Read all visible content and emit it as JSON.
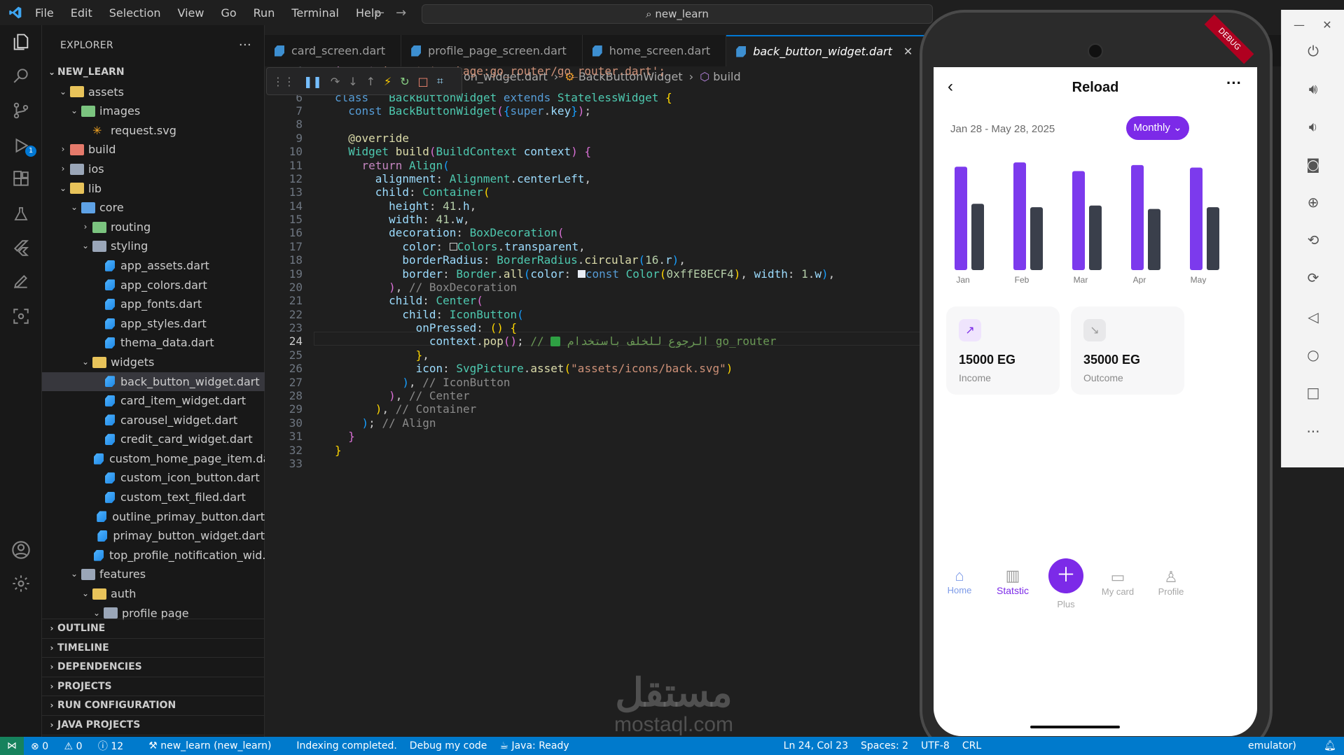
{
  "menu": [
    "File",
    "Edit",
    "Selection",
    "View",
    "Go",
    "Run",
    "Terminal",
    "Help"
  ],
  "search": {
    "text": "new_learn"
  },
  "explorer": {
    "title": "EXPLORER",
    "root": "NEW_LEARN",
    "tree": [
      {
        "label": "assets",
        "depth": 1,
        "kind": "folder-open",
        "color": "yel"
      },
      {
        "label": "images",
        "depth": 2,
        "kind": "folder-open",
        "color": "green"
      },
      {
        "label": "request.svg",
        "depth": 3,
        "kind": "svg"
      },
      {
        "label": "build",
        "depth": 1,
        "kind": "folder",
        "color": "red"
      },
      {
        "label": "ios",
        "depth": 1,
        "kind": "folder",
        "color": "grey"
      },
      {
        "label": "lib",
        "depth": 1,
        "kind": "folder-open",
        "color": "yel"
      },
      {
        "label": "core",
        "depth": 2,
        "kind": "folder-open",
        "color": "blue"
      },
      {
        "label": "routing",
        "depth": 3,
        "kind": "folder",
        "color": "green"
      },
      {
        "label": "styling",
        "depth": 3,
        "kind": "folder-open",
        "color": "grey"
      },
      {
        "label": "app_assets.dart",
        "depth": 4,
        "kind": "dart"
      },
      {
        "label": "app_colors.dart",
        "depth": 4,
        "kind": "dart"
      },
      {
        "label": "app_fonts.dart",
        "depth": 4,
        "kind": "dart"
      },
      {
        "label": "app_styles.dart",
        "depth": 4,
        "kind": "dart"
      },
      {
        "label": "thema_data.dart",
        "depth": 4,
        "kind": "dart"
      },
      {
        "label": "widgets",
        "depth": 3,
        "kind": "folder-open",
        "color": "yel"
      },
      {
        "label": "back_button_widget.dart",
        "depth": 4,
        "kind": "dart",
        "selected": true
      },
      {
        "label": "card_item_widget.dart",
        "depth": 4,
        "kind": "dart"
      },
      {
        "label": "carousel_widget.dart",
        "depth": 4,
        "kind": "dart"
      },
      {
        "label": "credit_card_widget.dart",
        "depth": 4,
        "kind": "dart"
      },
      {
        "label": "custom_home_page_item.dart",
        "depth": 4,
        "kind": "dart"
      },
      {
        "label": "custom_icon_button.dart",
        "depth": 4,
        "kind": "dart"
      },
      {
        "label": "custom_text_filed.dart",
        "depth": 4,
        "kind": "dart"
      },
      {
        "label": "outline_primay_button.dart",
        "depth": 4,
        "kind": "dart"
      },
      {
        "label": "primay_button_widget.dart",
        "depth": 4,
        "kind": "dart"
      },
      {
        "label": "top_profile_notification_wid...",
        "depth": 4,
        "kind": "dart"
      },
      {
        "label": "features",
        "depth": 2,
        "kind": "folder-open",
        "color": "grey"
      },
      {
        "label": "auth",
        "depth": 3,
        "kind": "folder-open",
        "color": "yel"
      },
      {
        "label": "profile page",
        "depth": 4,
        "kind": "folder-open",
        "color": "grey"
      }
    ],
    "sections": [
      "OUTLINE",
      "TIMELINE",
      "DEPENDENCIES",
      "PROJECTS",
      "RUN CONFIGURATION",
      "JAVA PROJECTS"
    ]
  },
  "tabs": [
    {
      "label": "card_screen.dart",
      "active": false
    },
    {
      "label": "profile_page_screen.dart",
      "active": false
    },
    {
      "label": "home_screen.dart",
      "active": false
    },
    {
      "label": "back_button_widget.dart",
      "active": true
    }
  ],
  "breadcrumb": {
    "file": "on_widget.dart",
    "cls": "BackButtonWidget",
    "method": "build"
  },
  "code": {
    "line4": "import 'package:go_router/go_router.dart';",
    "comment24": "الرجوع للخلف باستخدام go_router",
    "current_line": 24
  },
  "phone": {
    "debug": "DEBUG",
    "title": "Reload",
    "daterange": "Jan 28 - May 28, 2025",
    "filter": "Monthly",
    "income": {
      "amount": "15000 EG",
      "label": "Income"
    },
    "outcome": {
      "amount": "35000 EG",
      "label": "Outcome"
    },
    "nav": [
      {
        "label": "Home",
        "icon": "home-icon",
        "active": true
      },
      {
        "label": "Statstic",
        "icon": "chart-icon",
        "active": true
      },
      {
        "label": "Plus",
        "icon": "plus-icon",
        "active": false
      },
      {
        "label": "My card",
        "icon": "card-icon",
        "active": false
      },
      {
        "label": "Profile",
        "icon": "profile-icon",
        "active": false
      }
    ],
    "accent": "#7c2ae8"
  },
  "chart_data": {
    "type": "bar",
    "categories": [
      "Jan",
      "Feb",
      "Mar",
      "Apr",
      "May"
    ],
    "series": [
      {
        "values": [
          120,
          125,
          115,
          122,
          119
        ],
        "color": "#7c3aed"
      },
      {
        "values": [
          77,
          73,
          75,
          71,
          73
        ],
        "color": "#3a3f4b"
      }
    ],
    "ylim": [
      0,
      130
    ],
    "grid": false
  },
  "watermark": {
    "arabic": "مستقل",
    "latin": "mostaql.com"
  },
  "statusbar": {
    "errors": "0",
    "warnings": "0",
    "info": "12",
    "project": "new_learn (new_learn)",
    "indexing": "Indexing completed.",
    "debug": "Debug my code",
    "java": "Java: Ready",
    "position": "Ln 24, Col 23",
    "spaces": "Spaces: 2",
    "encoding": "UTF-8",
    "eol": "CRL",
    "device": "emulator)"
  }
}
